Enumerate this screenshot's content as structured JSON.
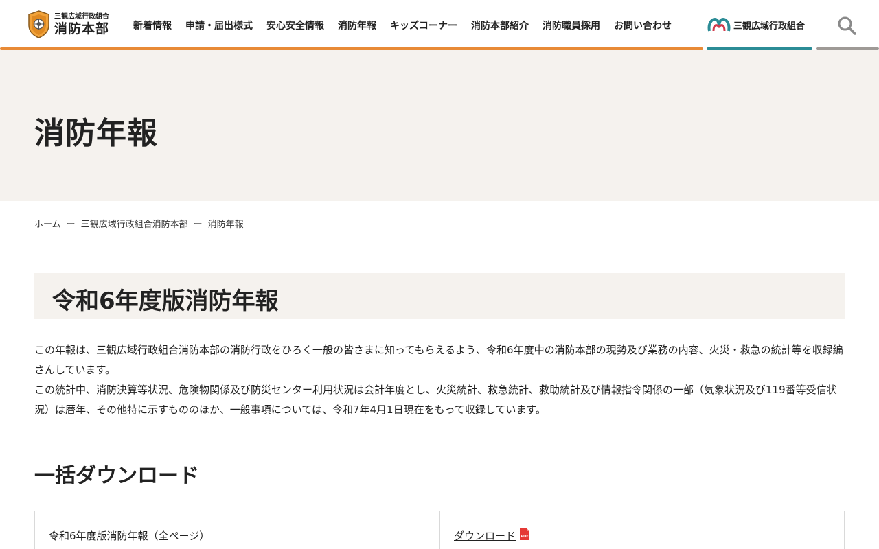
{
  "header": {
    "logo_small": "三観広域行政組合",
    "logo_big": "消防本部",
    "nav": [
      "新着情報",
      "申請・届出様式",
      "安心安全情報",
      "消防年報",
      "キッズコーナー",
      "消防本部紹介",
      "消防職員採用",
      "お問い合わせ"
    ],
    "kumiai_label": "三観広域行政組合",
    "colors": {
      "orange": "#e88a36",
      "teal": "#2b8c96",
      "gray": "#9e9a96"
    },
    "icons": {
      "search": "search-icon",
      "emblem": "fire-dept-emblem-icon",
      "kumiai": "kumiai-logo-icon"
    }
  },
  "hero": {
    "title": "消防年報"
  },
  "breadcrumb": [
    "ホーム",
    "三観広域行政組合消防本部",
    "消防年報"
  ],
  "section": {
    "title": "令和6年度版消防年報"
  },
  "intro": {
    "p1": "この年報は、三観広域行政組合消防本部の消防行政をひろく一般の皆さまに知ってもらえるよう、令和6年度中の消防本部の現勢及び業務の内容、火災・救急の統計等を収録編さんしています。",
    "p2": "この統計中、消防決算等状況、危険物関係及び防災センター利用状況は会計年度とし、火災統計、救急統計、救助統計及び情報指令関係の一部（気象状況及び119番等受信状況）は暦年、その他特に示すもののほか、一般事項については、令和7年4月1日現在をもって収録しています。"
  },
  "download": {
    "title": "一括ダウンロード",
    "rows": [
      {
        "name": "令和6年度版消防年報（全ページ）",
        "link": "ダウンロード",
        "icon": "pdf-icon"
      }
    ]
  }
}
